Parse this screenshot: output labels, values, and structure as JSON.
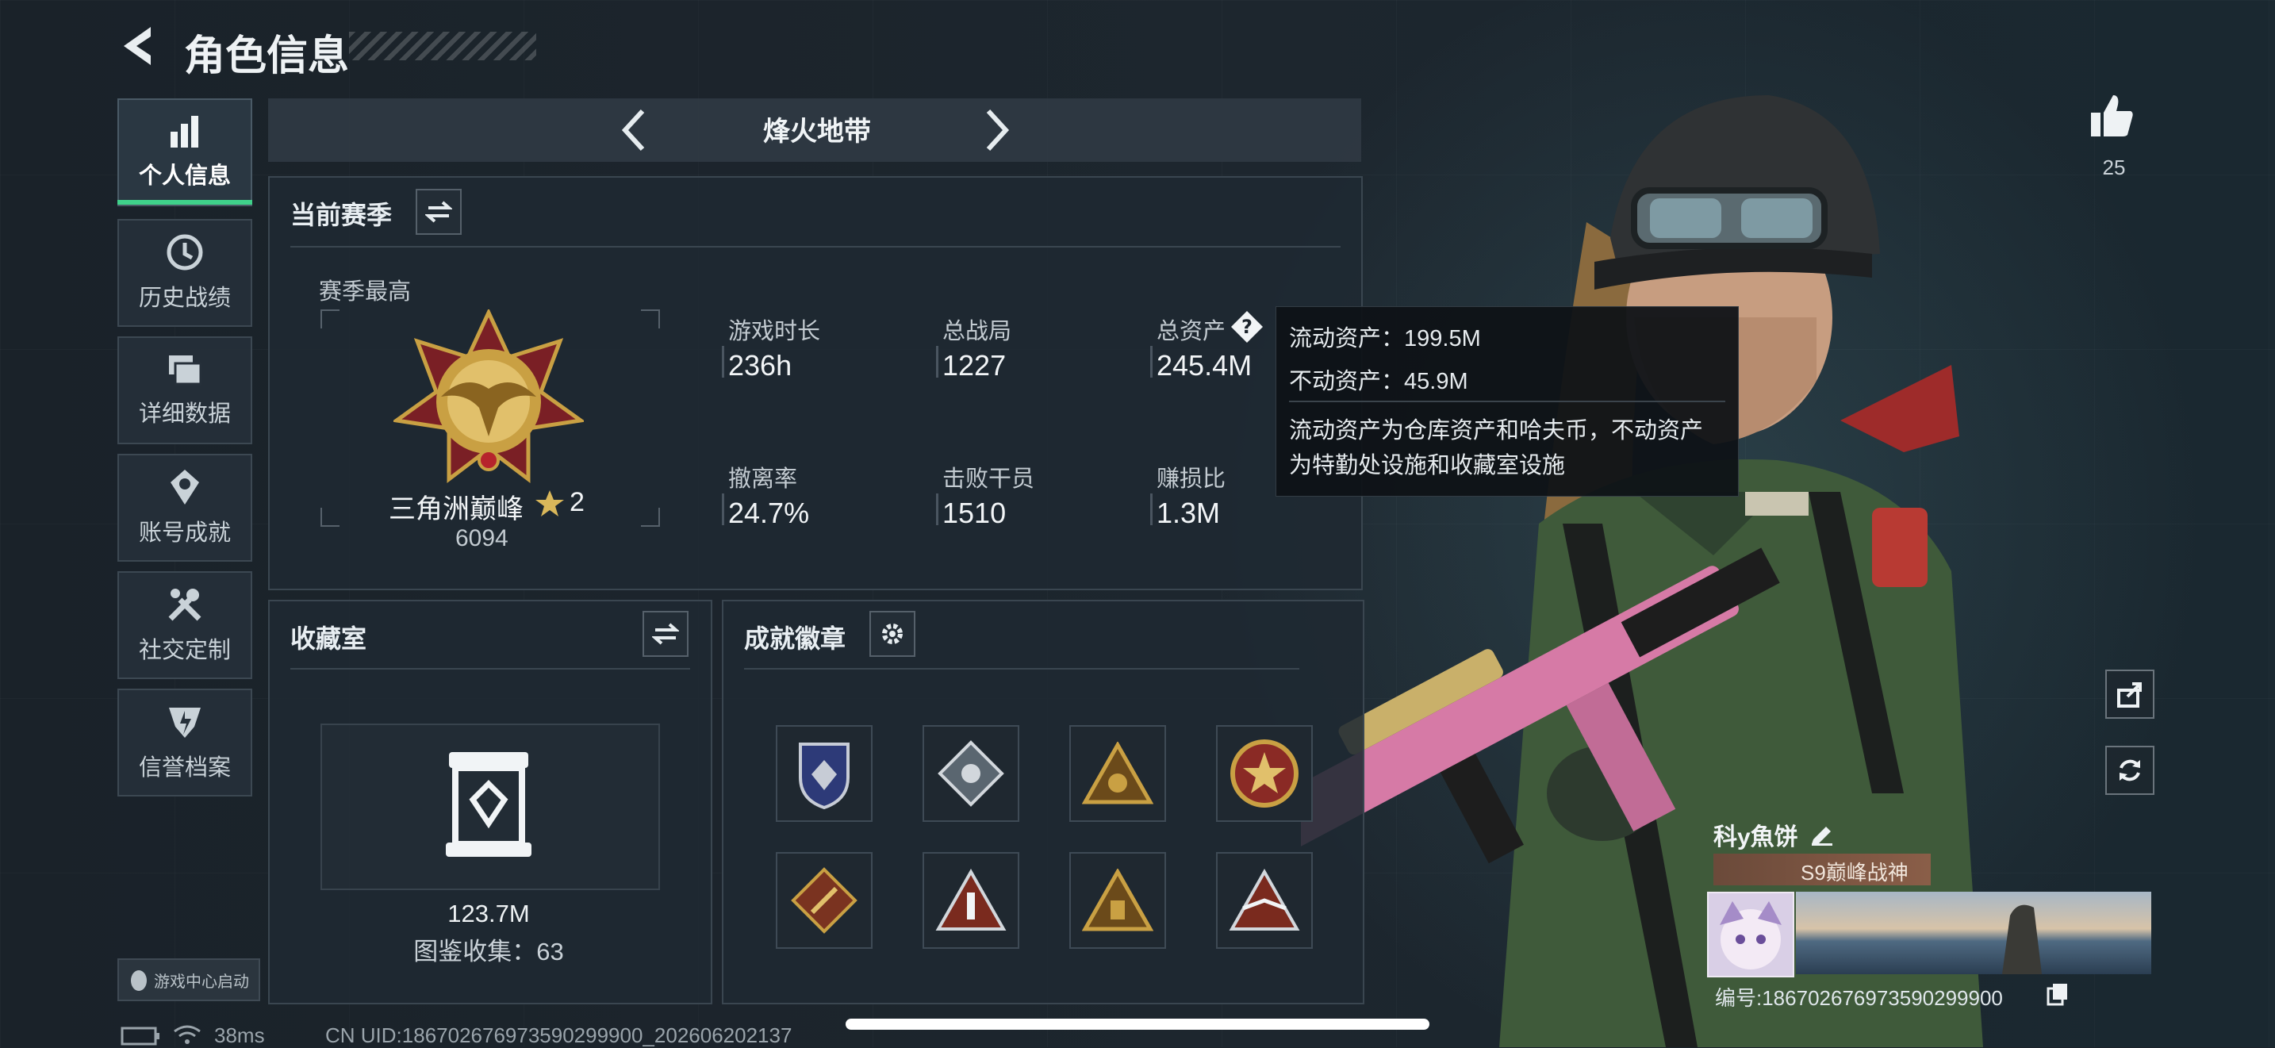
{
  "header": {
    "title": "角色信息"
  },
  "nav": {
    "items": [
      {
        "label": "个人信息",
        "active": true,
        "icon": "bar-chart-icon"
      },
      {
        "label": "历史战绩",
        "active": false,
        "icon": "history-clock-icon"
      },
      {
        "label": "详细数据",
        "active": false,
        "icon": "data-folder-icon"
      },
      {
        "label": "账号成就",
        "active": false,
        "icon": "achievement-medal-icon"
      },
      {
        "label": "社交定制",
        "active": false,
        "icon": "tools-icon"
      },
      {
        "label": "信誉档案",
        "active": false,
        "icon": "credit-shield-icon"
      }
    ],
    "launch_label": "游戏中心启动"
  },
  "mode": {
    "title": "烽火地带"
  },
  "season": {
    "title": "当前赛季",
    "best_label": "赛季最高",
    "rank_name": "三角洲巅峰",
    "rank_stars": "2",
    "rank_score": "6094",
    "stats": [
      {
        "label": "游戏时长",
        "value": "236h"
      },
      {
        "label": "总战局",
        "value": "1227"
      },
      {
        "label": "总资产",
        "value": "245.4M"
      },
      {
        "label": "撤离率",
        "value": "24.7%"
      },
      {
        "label": "击败干员",
        "value": "1510"
      },
      {
        "label": "赚损比",
        "value": "1.3M"
      }
    ]
  },
  "tooltip": {
    "liquid": "流动资产：199.5M",
    "fixed": "不动资产：45.9M",
    "desc_line1": "流动资产为仓库资产和哈夫币，不动资产",
    "desc_line2": "为特勤处设施和收藏室设施"
  },
  "collection": {
    "title": "收藏室",
    "value": "123.7M",
    "catalog": "图鉴收集：63"
  },
  "achievements": {
    "title": "成就徽章",
    "badges": [
      "badge-1",
      "badge-2",
      "badge-3",
      "badge-4",
      "badge-5",
      "badge-6",
      "badge-7",
      "badge-8"
    ]
  },
  "player": {
    "name": "科y魚饼",
    "title_badge": "S9巅峰战神",
    "id_line": "编号:18670267697359029990​0",
    "likes": "25"
  },
  "statusbar": {
    "ping": "38ms",
    "uid": "CN UID:18670267697359029990​0_20260620​2137"
  },
  "colors": {
    "accent_green": "#3fd18a",
    "panel_border": "#3a4650",
    "gold": "#c9a043"
  }
}
